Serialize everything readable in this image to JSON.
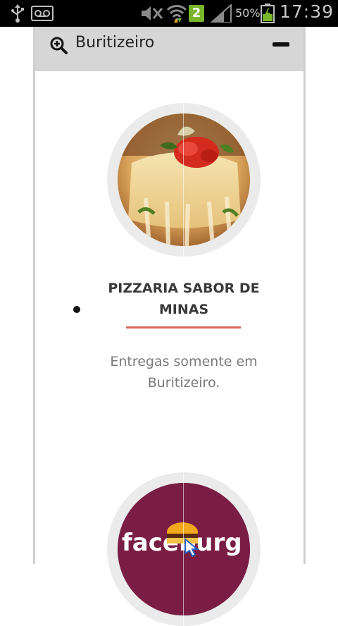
{
  "status_bar": {
    "battery_percent": "50%",
    "time": "17:39",
    "sim_slot": "2",
    "icons": [
      "usb-icon",
      "voicemail-icon",
      "mute-icon",
      "wifi-icon",
      "signal-icon",
      "battery-icon"
    ]
  },
  "header": {
    "title": "Buritizeiro",
    "search_icon": "zoom-in-icon",
    "collapse_icon": "minus-icon"
  },
  "store": {
    "name": "PIZZARIA SABOR DE MINAS",
    "description": "Entregas somente em Buritizeiro.",
    "image": "pizza-photo",
    "accent_color": "#d9665d"
  },
  "next_store": {
    "logo": "faceburg-logo",
    "logo_text": "faceburg"
  }
}
